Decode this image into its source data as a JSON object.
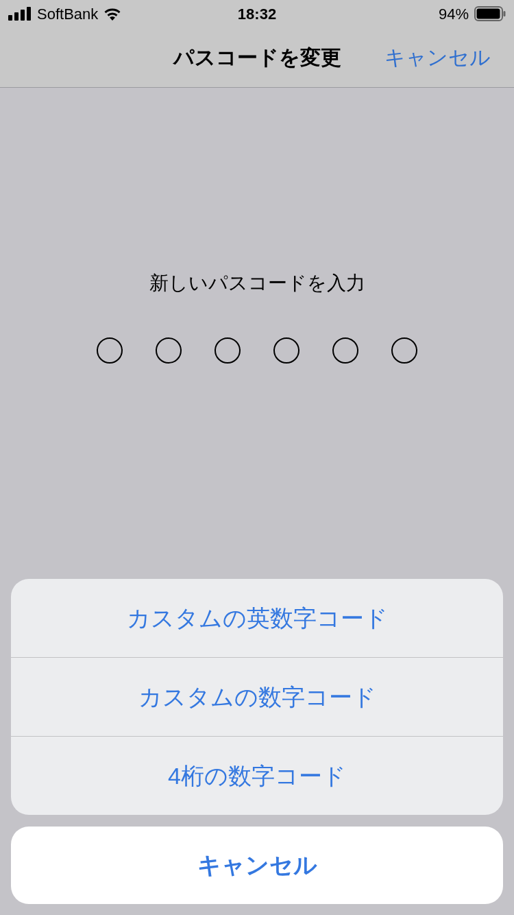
{
  "status_bar": {
    "carrier": "SoftBank",
    "time": "18:32",
    "battery": "94%"
  },
  "nav": {
    "title": "パスコードを変更",
    "action": "キャンセル"
  },
  "prompt": "新しいパスコードを入力",
  "passcode_dots": [
    {
      "filled": false
    },
    {
      "filled": false
    },
    {
      "filled": false
    },
    {
      "filled": false
    },
    {
      "filled": false
    },
    {
      "filled": false
    }
  ],
  "action_sheet": {
    "options": [
      "カスタムの英数字コード",
      "カスタムの数字コード",
      "4桁の数字コード"
    ],
    "cancel": "キャンセル"
  }
}
